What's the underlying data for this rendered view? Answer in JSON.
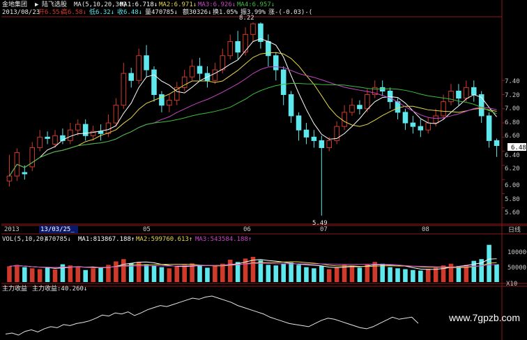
{
  "header": {
    "stock_name": "金地集团",
    "arrow": "▶",
    "indicator_name": "陆飞选股",
    "ma_params": "MA(5,10,20,30)",
    "ma1": "MA1:6.718↓",
    "ma2": "MA2:6.971↓",
    "ma3": "MA3:6.926↓",
    "ma4": "MA4:6.957↓"
  },
  "info_bar": {
    "date": "2013/08/23",
    "open": "开6.55↑",
    "high": "高6.58↓",
    "low": "低6.32↓",
    "close": "收6.48↓",
    "volume": "量470785↓",
    "amount": "额30326↓",
    "turnover": "换1.05%",
    "amplitude": "振3.99%",
    "change": "涨-(-0.03)-(",
    "peak_label": "8.22",
    "trough_label": "5.49"
  },
  "right_axis": {
    "labels": [
      "7.40",
      "7.20",
      "7.00",
      "6.80",
      "6.60",
      "6.40",
      "6.20",
      "6.00",
      "5.80",
      "5.60"
    ],
    "current_price": "6.48",
    "period": "日线"
  },
  "date_axis": {
    "labels": [
      "2013",
      "13/03/25_",
      "05",
      "06",
      "07",
      "08"
    ]
  },
  "volume_panel": {
    "title": "VOL(5,10,20)",
    "value": "470785↓",
    "ma1": "MA1:813867.188↑",
    "ma2": "MA2:599760.613↑",
    "ma3": "MA3:543584.188↑",
    "axis_labels": [
      "100000",
      "50000",
      "X10"
    ]
  },
  "indicator_panel": {
    "title": "主力收益",
    "value": "主力收益:40.260↓"
  },
  "watermark": "www.7gpzb.com",
  "colors": {
    "up": "#d03a2a",
    "down": "#5ee8ee",
    "ma1": "#ffffff",
    "ma2": "#e8d84a",
    "ma3": "#c846c8",
    "ma4": "#3cbf3c",
    "grid": "#8a1a1a",
    "axis_text": "#c8c8c8"
  },
  "chart_data": {
    "type": "candlestick",
    "price_scale": [
      5.49,
      8.22
    ],
    "candles": [
      [
        5.98,
        6.05,
        6.35,
        5.9
      ],
      [
        6.05,
        6.38,
        6.44,
        5.98
      ],
      [
        6.1,
        6.08,
        6.2,
        6.0
      ],
      [
        6.18,
        6.45,
        6.53,
        6.12
      ],
      [
        6.45,
        6.6,
        6.7,
        6.4
      ],
      [
        6.6,
        6.58,
        6.68,
        6.5
      ],
      [
        6.5,
        6.62,
        6.7,
        6.45
      ],
      [
        6.62,
        6.55,
        6.72,
        6.5
      ],
      [
        6.55,
        6.7,
        6.8,
        6.5
      ],
      [
        6.7,
        6.78,
        6.85,
        6.62
      ],
      [
        6.78,
        6.62,
        6.85,
        6.55
      ],
      [
        6.62,
        6.68,
        6.76,
        6.55
      ],
      [
        6.68,
        6.65,
        6.78,
        6.55
      ],
      [
        6.65,
        6.8,
        6.92,
        6.6
      ],
      [
        6.8,
        7.05,
        7.15,
        6.75
      ],
      [
        7.05,
        7.5,
        7.65,
        7.0
      ],
      [
        7.5,
        7.4,
        7.58,
        7.3
      ],
      [
        7.4,
        7.75,
        7.85,
        7.35
      ],
      [
        7.75,
        7.55,
        7.9,
        7.45
      ],
      [
        7.55,
        7.2,
        7.6,
        7.1
      ],
      [
        7.2,
        7.05,
        7.25,
        6.95
      ],
      [
        7.05,
        7.12,
        7.2,
        6.95
      ],
      [
        7.12,
        7.3,
        7.38,
        7.05
      ],
      [
        7.3,
        7.45,
        7.55,
        7.25
      ],
      [
        7.45,
        7.6,
        7.7,
        7.4
      ],
      [
        7.6,
        7.5,
        7.72,
        7.4
      ],
      [
        7.5,
        7.4,
        7.6,
        7.3
      ],
      [
        7.4,
        7.55,
        7.65,
        7.35
      ],
      [
        7.55,
        7.75,
        7.85,
        7.5
      ],
      [
        7.75,
        7.95,
        8.05,
        7.7
      ],
      [
        7.95,
        7.8,
        8.1,
        7.7
      ],
      [
        7.8,
        8.05,
        8.15,
        7.75
      ],
      [
        8.05,
        8.2,
        8.22,
        7.95
      ],
      [
        8.2,
        7.95,
        8.22,
        7.85
      ],
      [
        7.95,
        7.75,
        8.05,
        7.6
      ],
      [
        7.75,
        7.55,
        7.8,
        7.4
      ],
      [
        7.55,
        7.2,
        7.6,
        7.05
      ],
      [
        7.2,
        6.9,
        7.25,
        6.8
      ],
      [
        6.9,
        6.7,
        6.95,
        6.55
      ],
      [
        6.7,
        6.6,
        6.8,
        6.5
      ],
      [
        6.6,
        6.55,
        6.7,
        6.45
      ],
      [
        6.55,
        6.45,
        6.62,
        5.49
      ],
      [
        6.45,
        6.55,
        6.6,
        6.4
      ],
      [
        6.55,
        6.75,
        6.82,
        6.5
      ],
      [
        6.75,
        6.95,
        7.05,
        6.7
      ],
      [
        6.95,
        7.05,
        7.15,
        6.9
      ],
      [
        7.05,
        7.0,
        7.12,
        6.92
      ],
      [
        7.0,
        7.2,
        7.28,
        6.95
      ],
      [
        7.2,
        7.3,
        7.4,
        7.15
      ],
      [
        7.3,
        7.25,
        7.4,
        7.18
      ],
      [
        7.25,
        7.1,
        7.3,
        7.0
      ],
      [
        7.1,
        6.95,
        7.15,
        6.85
      ],
      [
        6.95,
        6.8,
        7.0,
        6.7
      ],
      [
        6.8,
        6.75,
        6.9,
        6.65
      ],
      [
        6.75,
        6.7,
        6.85,
        6.6
      ],
      [
        6.7,
        6.8,
        6.88,
        6.65
      ],
      [
        6.8,
        6.9,
        7.0,
        6.75
      ],
      [
        6.9,
        7.1,
        7.2,
        6.85
      ],
      [
        7.1,
        7.25,
        7.35,
        7.05
      ],
      [
        7.25,
        7.15,
        7.35,
        7.05
      ],
      [
        7.15,
        7.3,
        7.4,
        7.1
      ],
      [
        7.3,
        7.2,
        7.4,
        7.1
      ],
      [
        7.2,
        6.9,
        7.25,
        6.8
      ],
      [
        6.9,
        6.55,
        6.95,
        6.45
      ],
      [
        6.55,
        6.48,
        6.58,
        6.32
      ]
    ],
    "volumes": [
      55,
      60,
      52,
      48,
      45,
      50,
      44,
      62,
      58,
      55,
      42,
      48,
      50,
      60,
      72,
      80,
      66,
      70,
      62,
      58,
      52,
      48,
      55,
      60,
      65,
      58,
      50,
      56,
      64,
      78,
      70,
      82,
      88,
      76,
      60,
      58,
      65,
      68,
      60,
      52,
      48,
      56,
      45,
      52,
      60,
      58,
      50,
      62,
      70,
      64,
      52,
      48,
      45,
      42,
      40,
      46,
      50,
      58,
      64,
      56,
      60,
      74,
      80,
      130,
      62
    ],
    "indicator": [
      20,
      22,
      18,
      25,
      28,
      24,
      30,
      34,
      32,
      38,
      36,
      40,
      42,
      45,
      50,
      56,
      54,
      60,
      58,
      62,
      55,
      60,
      66,
      70,
      74,
      72,
      76,
      80,
      84,
      88,
      86,
      90,
      92,
      88,
      84,
      80,
      74,
      70,
      66,
      62,
      58,
      52,
      48,
      44,
      40,
      38,
      36,
      34,
      40,
      46,
      50,
      48,
      44,
      40,
      36,
      32,
      30,
      34,
      40,
      46,
      52,
      48,
      50,
      52,
      40.26
    ]
  }
}
